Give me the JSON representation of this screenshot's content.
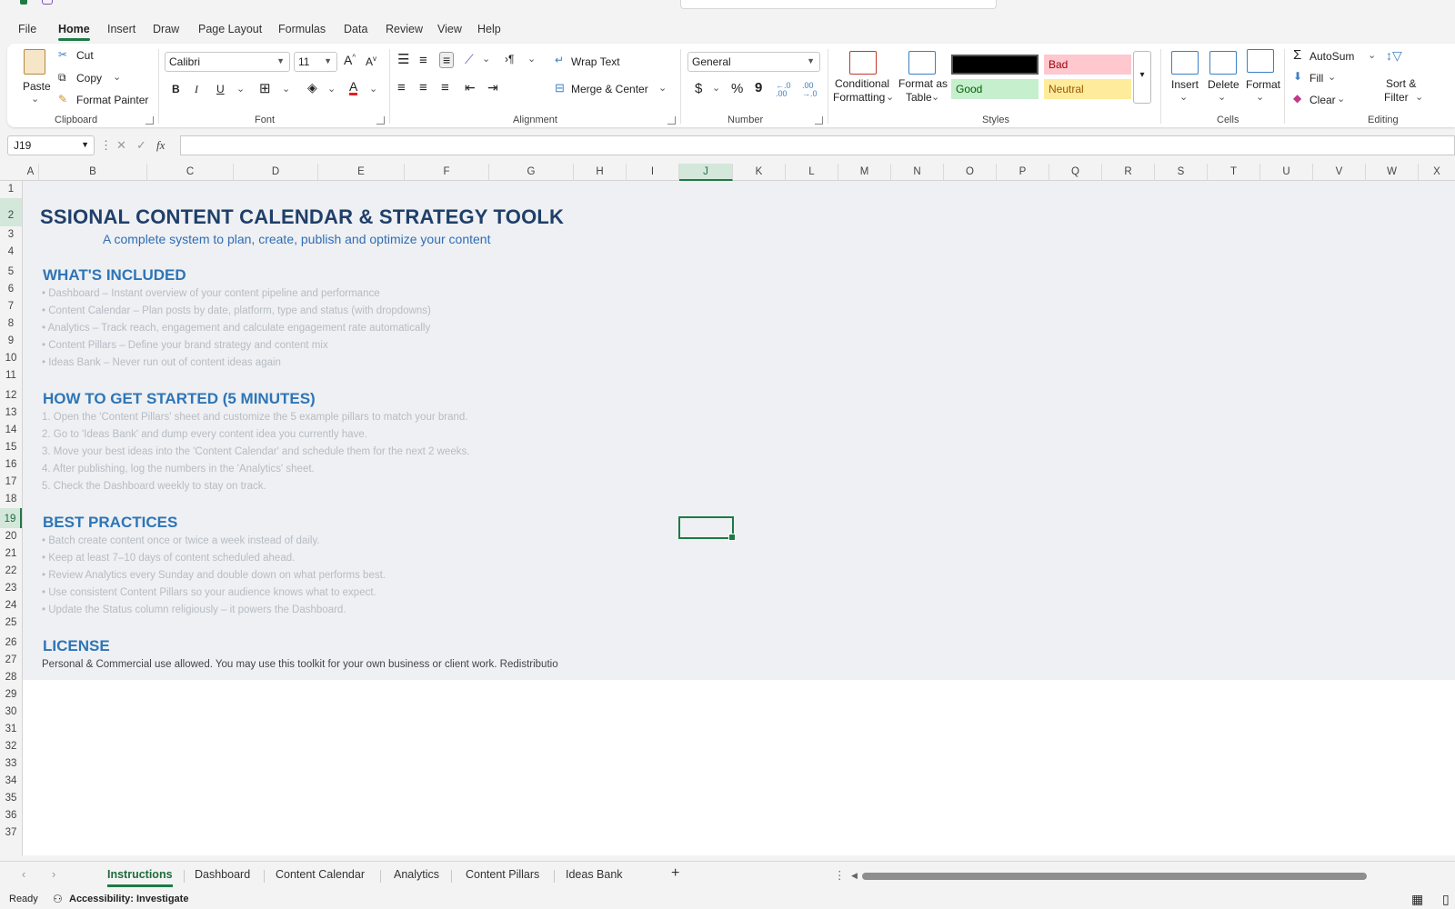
{
  "menu": [
    "File",
    "Home",
    "Insert",
    "Draw",
    "Page Layout",
    "Formulas",
    "Data",
    "Review",
    "View",
    "Help"
  ],
  "menu_active": "Home",
  "ribbon": {
    "clipboard": {
      "paste": "Paste",
      "cut": "Cut",
      "copy": "Copy",
      "format_painter": "Format Painter",
      "label": "Clipboard"
    },
    "font": {
      "name": "Calibri",
      "size": "11",
      "bold": "B",
      "italic": "I",
      "underline": "U",
      "grow": "A",
      "shrink": "A",
      "font_color": "A",
      "label": "Font"
    },
    "alignment": {
      "wrap": "Wrap Text",
      "merge": "Merge & Center",
      "label": "Alignment"
    },
    "number": {
      "format": "General",
      "currency": "$",
      "percent": "%",
      "comma": "9",
      "inc": "←.0 .00",
      "dec": ".00 →.0",
      "label": "Number"
    },
    "styles": {
      "conditional": "Conditional Formatting",
      "conditional_l1": "Conditional",
      "conditional_l2": "Formatting",
      "table_l1": "Format as",
      "table_l2": "Table",
      "bad": "Bad",
      "good": "Good",
      "neutral": "Neutral",
      "label": "Styles"
    },
    "cells": {
      "insert": "Insert",
      "delete": "Delete",
      "format": "Format",
      "label": "Cells"
    },
    "editing": {
      "autosum": "AutoSum",
      "fill": "Fill",
      "clear": "Clear",
      "sort_l1": "Sort &",
      "sort_l2": "Filter",
      "label": "Editing"
    }
  },
  "formula_bar": {
    "name_box": "J19",
    "fx": "fx",
    "formula": ""
  },
  "columns": [
    "A",
    "B",
    "C",
    "D",
    "E",
    "F",
    "G",
    "H",
    "I",
    "J",
    "K",
    "L",
    "M",
    "N",
    "O",
    "P",
    "Q",
    "R",
    "S",
    "T",
    "U",
    "V",
    "W",
    "X"
  ],
  "selected_column": "J",
  "rows": [
    "1",
    "2",
    "3",
    "4",
    "5",
    "6",
    "7",
    "8",
    "9",
    "10",
    "11",
    "12",
    "13",
    "14",
    "15",
    "16",
    "17",
    "18",
    "19",
    "20",
    "21",
    "22",
    "23",
    "24",
    "25",
    "26",
    "27",
    "28",
    "29",
    "30",
    "31",
    "32",
    "33",
    "34",
    "35",
    "36",
    "37"
  ],
  "selected_row": "19",
  "sheet": {
    "title": "SSIONAL CONTENT CALENDAR & STRATEGY TOOLK",
    "subtitle": "A complete system to plan, create, publish and optimize your content",
    "whats_included": {
      "heading": "WHAT'S INCLUDED",
      "items": [
        "• Dashboard – Instant overview of your content pipeline and performance",
        "• Content Calendar – Plan posts by date, platform, type and status (with dropdowns)",
        "• Analytics – Track reach, engagement and calculate engagement rate automatically",
        "• Content Pillars – Define your brand strategy and content mix",
        "• Ideas Bank – Never run out of content ideas again"
      ]
    },
    "getting_started": {
      "heading": "HOW TO GET STARTED (5 MINUTES)",
      "items": [
        "1. Open the 'Content Pillars' sheet and customize the 5 example pillars to match your brand.",
        "2. Go to 'Ideas Bank' and dump every content idea you currently have.",
        "3. Move your best ideas into the 'Content Calendar' and schedule them for the next 2 weeks.",
        "4. After publishing, log the numbers in the 'Analytics' sheet.",
        "5. Check the Dashboard weekly to stay on track."
      ]
    },
    "best_practices": {
      "heading": "BEST PRACTICES",
      "items": [
        "• Batch create content once or twice a week instead of daily.",
        "• Keep at least 7–10 days of content scheduled ahead.",
        "• Review Analytics every Sunday and double down on what performs best.",
        "• Use consistent Content Pillars so your audience knows what to expect.",
        "• Update the Status column religiously – it powers the Dashboard."
      ]
    },
    "license": {
      "heading": "LICENSE",
      "text": "Personal & Commercial use allowed. You may use this toolkit for your own business or client work. Redistributio"
    }
  },
  "tabs": [
    "Instructions",
    "Dashboard",
    "Content Calendar",
    "Analytics",
    "Content Pillars",
    "Ideas Bank"
  ],
  "tab_active": "Instructions",
  "status": {
    "ready": "Ready",
    "accessibility": "Accessibility: Investigate"
  },
  "colors": {
    "accent": "#1e7a45",
    "title": "#1f3f6a",
    "section": "#2e75b6",
    "bad_bg": "#ffc7ce",
    "bad_fg": "#9c0006",
    "good_bg": "#c6efce",
    "good_fg": "#006100",
    "neutral_bg": "#ffeb9c",
    "neutral_fg": "#9c5700"
  }
}
